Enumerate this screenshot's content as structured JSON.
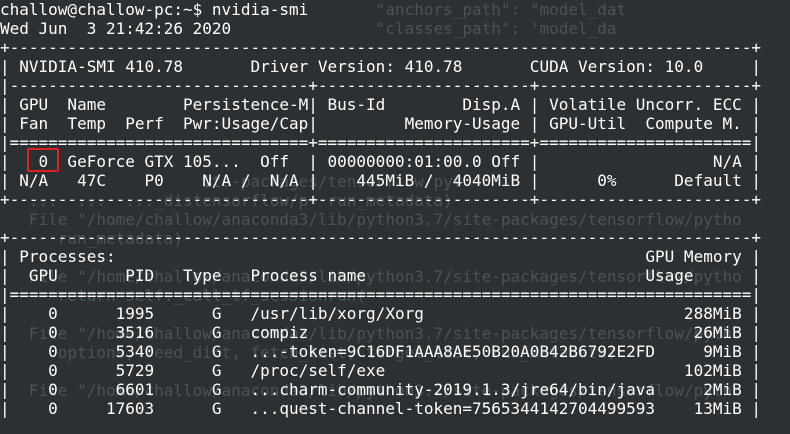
{
  "terminal": {
    "prompt": "challow@challow-pc:~$ nvidia-smi",
    "timestamp": "Wed Jun  3 21:42:26 2020"
  },
  "smi": {
    "header_border": "+-----------------------------------------------------------------------------+",
    "header": "| NVIDIA-SMI 410.78       Driver Version: 410.78       CUDA Version: 10.0     |",
    "table_top": "|-------------------------------+----------------------+----------------------+",
    "col1": "| GPU  Name        Persistence-M| Bus-Id        Disp.A | Volatile Uncorr. ECC |",
    "col2": "| Fan  Temp  Perf  Pwr:Usage/Cap|         Memory-Usage | GPU-Util  Compute M. |",
    "sep_eq": "|===============================+======================+======================|",
    "gpu_row1": "|   0  GeForce GTX 105...  Off  | 00000000:01:00.0 Off |                  N/A |",
    "gpu_row2": "| N/A   47C    P0    N/A /  N/A |    445MiB /  4040MiB |      0%      Default |",
    "table_bottom": "+-------------------------------+----------------------+----------------------+",
    "blank": "",
    "proc_border": "+-----------------------------------------------------------------------------+",
    "proc_h1": "| Processes:                                                       GPU Memory |",
    "proc_h2": "|  GPU       PID   Type   Process name                             Usage      |",
    "proc_eq": "|=============================================================================|",
    "processes": [
      "|    0      1995      G   /usr/lib/xorg/Xorg                           288MiB |",
      "|    0      3516      G   compiz                                        26MiB |",
      "|    0      5340      G   ...-token=9C16DF1AAA8AE50B20A0B42B6792E2FD     9MiB |",
      "|    0      5729      G   /proc/self/exe                               102MiB |",
      "|    0      6601      G   ...charm-community-2019.1.3/jre64/bin/java     2MiB |",
      "|    0     17603      G   ...quest-channel-token=7565344142704499593    13MiB |"
    ]
  },
  "background_text": [
    "                                       \"anchors_path\": \"model_dat",
    "                                       \"classes_path\": 'model_da",
    "                                                                 ",
    "                                                                 ",
    "                                                                 ",
    "                                                                 ",
    "                                                                 ",
    "                                                                 ",
    "                     ite-packages/tensorflow/pyt",
    "   ...  ...  ..._distensorflow/p  run_metadata)",
    "   File \"/home/challow/anaconda3/lib/python3.7/site-packages/tensorflow/pytho",
    "      run_metadata)",
    "   File \"/home/challow/anaconda3/lib/python3.7/site-packages/tensorflow/pytho",
    "      return self._call_tf_sessionrun(",
    "   File \"/home/challow/anaconda3/lib/python3.7/site-packages/tensorflow/pytho",
    "      options, feed_dict, fetch_list, target_list, run_metadata)",
    "   File \"/home/challow/anaconda3/lib/python3.7/site-packages/tensorflow/pytho"
  ]
}
